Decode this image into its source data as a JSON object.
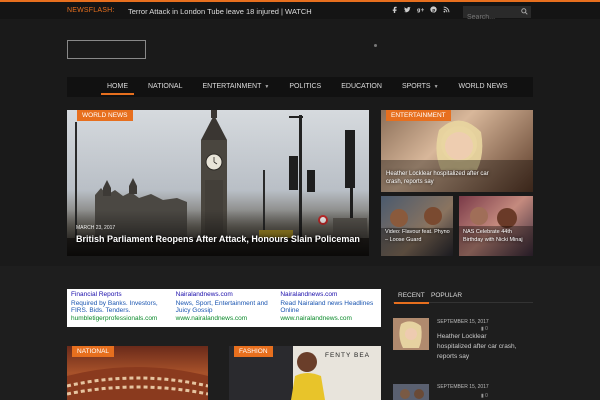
{
  "topbar": {
    "newsflash_label": "NEWSFLASH:",
    "ticker_text": "Terror Attack in London Tube leave 18 injured | WATCH",
    "social_icons": [
      "facebook-icon",
      "twitter-icon",
      "google-plus-icon",
      "pinterest-icon",
      "rss-icon"
    ],
    "search_placeholder": "Search..."
  },
  "nav": {
    "items": [
      {
        "label": "HOME",
        "active": true
      },
      {
        "label": "NATIONAL"
      },
      {
        "label": "ENTERTAINMENT",
        "dropdown": true
      },
      {
        "label": "POLITICS"
      },
      {
        "label": "EDUCATION"
      },
      {
        "label": "SPORTS",
        "dropdown": true
      },
      {
        "label": "WORLD NEWS"
      }
    ]
  },
  "featured": {
    "main": {
      "category": "WORLD NEWS",
      "date": "MARCH 23, 2017",
      "title": "British Parliament Reopens After Attack, Honours Slain Policeman"
    },
    "side_top": {
      "category": "ENTERTAINMENT",
      "title": "Heather Locklear hospitalized after car crash, reports say"
    },
    "side_small_1": {
      "title": "Video: Flavour feat. Phyno – Loose Guard"
    },
    "side_small_2": {
      "title": "NAS Celebrate 44th Birthday with Nicki Minaj"
    }
  },
  "ad": {
    "units": [
      {
        "title": "Financial Reports",
        "desc": "Required by Banks. Investors, FIRS. Bids. Tenders.",
        "url": "humbletigerprofessionals.com"
      },
      {
        "title": "Nairalandnews.com",
        "desc": "News, Sport, Entertainment and Juicy Gossip",
        "url": "www.nairalandnews.com"
      },
      {
        "title": "Nairalandnews.com",
        "desc": "Read Nairaland news Headlines Online",
        "url": "www.nairalandnews.com"
      }
    ]
  },
  "cards": {
    "national": {
      "category": "NATIONAL"
    },
    "fashion": {
      "category": "FASHION",
      "image_text": "FENTY BEA"
    }
  },
  "sidebar": {
    "tabs": [
      "RECENT",
      "POPULAR"
    ],
    "recent": [
      {
        "date": "SEPTEMBER 15, 2017",
        "comments": "0",
        "title": "Heather Locklear hospitalized after car crash, reports say"
      },
      {
        "date": "SEPTEMBER 15, 2017",
        "comments": "0",
        "title": ""
      }
    ]
  },
  "colors": {
    "accent": "#e76f1e",
    "background": "#1a1a1a",
    "nav_background": "#111111"
  }
}
